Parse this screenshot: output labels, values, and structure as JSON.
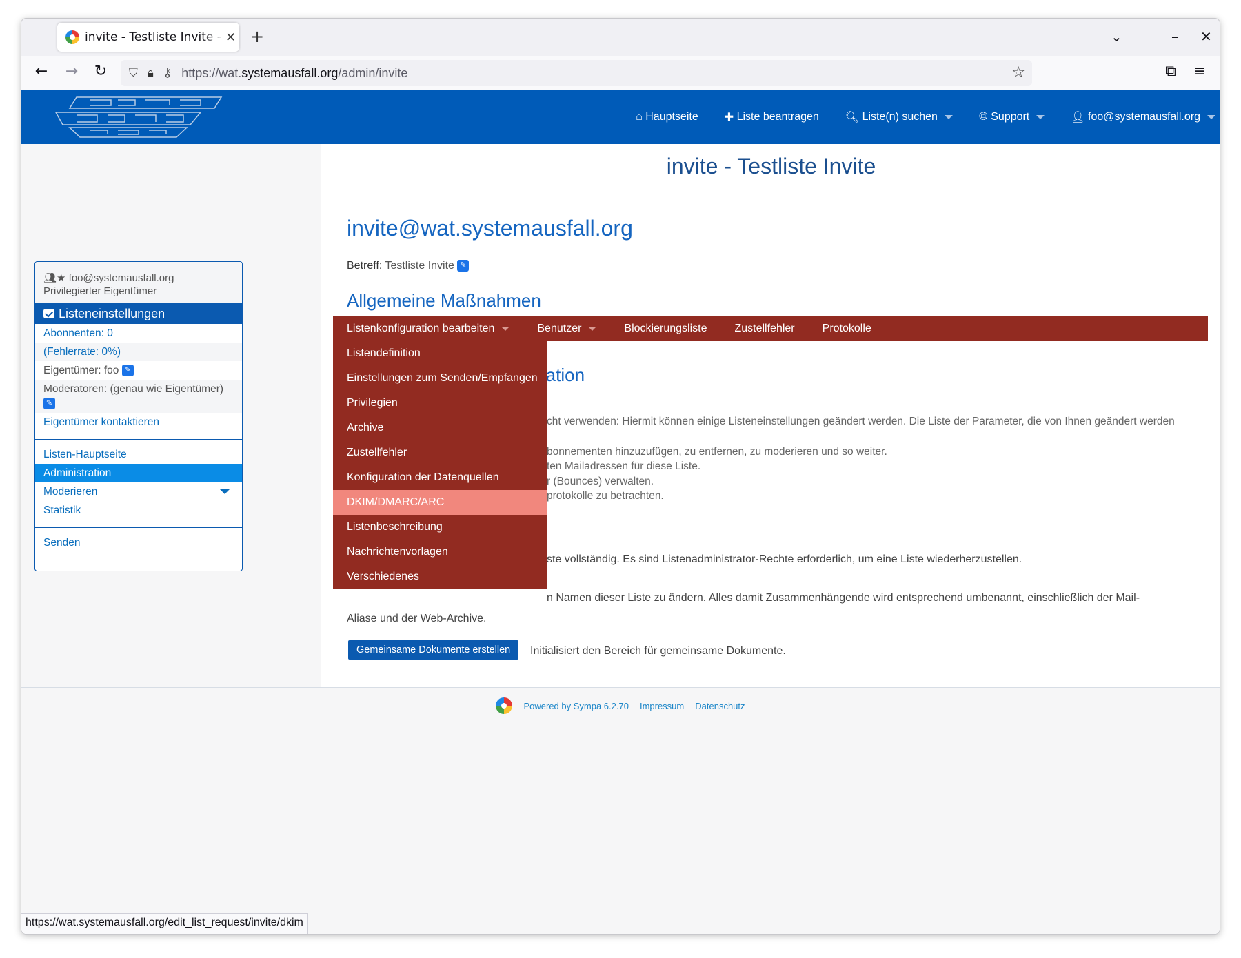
{
  "browser": {
    "tab_title": "invite - Testliste Invite - a",
    "tab_close": "✕",
    "new_tab": "+",
    "url_prefix": "https://wat.",
    "url_domain": "systemausfall.org",
    "url_path": "/admin/invite",
    "status_url": "https://wat.systemausfall.org/edit_list_request/invite/dkim"
  },
  "header": {
    "logo_alt": "systemausfall",
    "nav": [
      {
        "icon": "home-icon",
        "label": "Hauptseite"
      },
      {
        "icon": "plus-icon",
        "label": "Liste beantragen"
      },
      {
        "icon": "search-icon",
        "label": "Liste(n) suchen"
      },
      {
        "icon": "globe-icon",
        "label": "Support"
      },
      {
        "icon": "user-icon",
        "label": "foo@systemausfall.org"
      }
    ]
  },
  "page_title": "invite - Testliste Invite",
  "sidebar": {
    "user_email": "foo@systemausfall.org",
    "user_role": "Privilegierter Eigentümer",
    "section_title": "Listeneinstellungen",
    "subscribers": "Abonnenten: 0",
    "error_rate": "(Fehlerrate: 0%)",
    "owners": "Eigentümer: foo",
    "moderators": "Moderatoren: (genau wie Eigentümer)",
    "contact_owners": "Eigentümer kontaktieren",
    "nav": {
      "home": "Listen-Hauptseite",
      "admin": "Administration",
      "moderate": "Moderieren",
      "stats": "Statistik",
      "send": "Senden"
    }
  },
  "main": {
    "list_address": "invite@wat.systemausfall.org",
    "subject_label": "Betreff:",
    "subject_value": "Testliste Invite",
    "general_actions": "Allgemeine Maßnahmen",
    "menu": [
      "Listenkonfiguration bearbeiten",
      "Benutzer",
      "Blockierungsliste",
      "Zustellfehler",
      "Protokolle"
    ],
    "dropdown": [
      "Listendefinition",
      "Einstellungen zum Senden/Empfangen",
      "Privilegien",
      "Archive",
      "Zustellfehler",
      "Konfiguration der Datenquellen",
      "DKIM/DMARC/ARC",
      "Listenbeschreibung",
      "Nachrichtenvorlagen",
      "Verschiedenes"
    ],
    "config_heading_partial": "ration",
    "text_lines": [
      "cht verwenden: Hiermit können einige Listeneinstellungen geändert werden. Die Liste der Parameter, die von Ihnen geändert werden",
      "bonnementen hinzuzufügen, zu entfernen, zu moderieren und so weiter.",
      "ten Mailadressen für diese Liste.",
      "r (Bounces) verwalten.",
      "protokolle zu betrachten."
    ],
    "restore_text": "ste vollständig. Es sind Listenadministrator-Rechte erforderlich, um eine Liste wiederherzustellen.",
    "rename_text_1": "n Namen dieser Liste zu ändern. Alles damit Zusammenhängende wird entsprechend umbenannt, einschließlich der Mail-",
    "rename_text_2": "Aliase und der Web-Archive.",
    "docs_button": "Gemeinsame Dokumente erstellen",
    "docs_text": "Initialisiert den Bereich für gemeinsame Dokumente."
  },
  "footer": {
    "powered": "Powered by Sympa 6.2.70",
    "impressum": "Impressum",
    "privacy": "Datenschutz"
  }
}
